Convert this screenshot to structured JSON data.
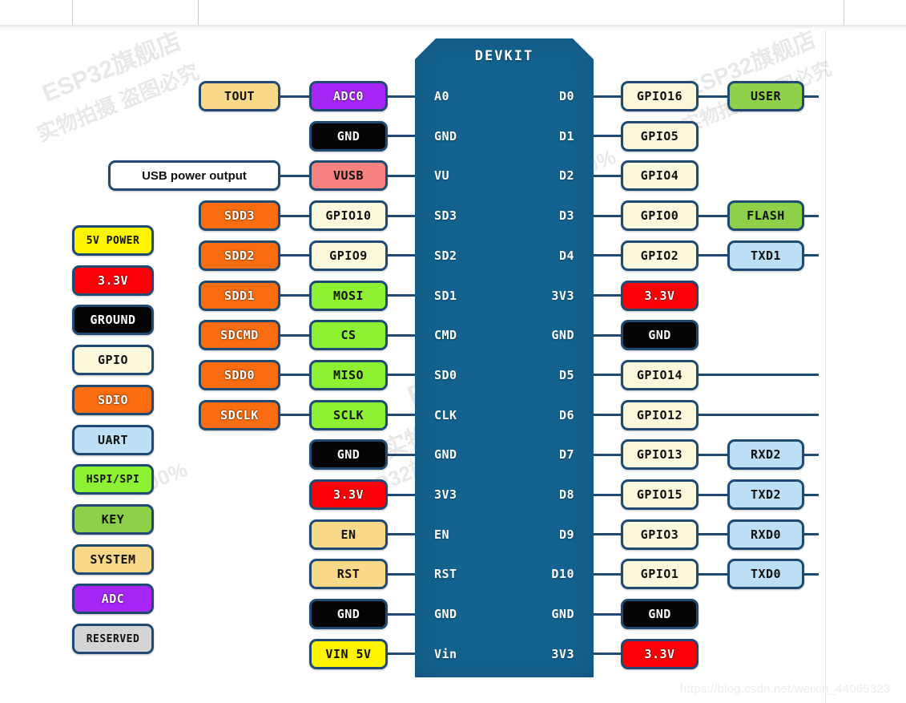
{
  "board": {
    "title": "DEVKIT",
    "left_pads": [
      "A0",
      "GND",
      "VU",
      "SD3",
      "SD2",
      "SD1",
      "CMD",
      "SD0",
      "CLK",
      "GND",
      "3V3",
      "EN",
      "RST",
      "GND",
      "Vin"
    ],
    "right_pads": [
      "D0",
      "D1",
      "D2",
      "D3",
      "D4",
      "3V3",
      "GND",
      "D5",
      "D6",
      "D7",
      "D8",
      "D9",
      "D10",
      "GND",
      "3V3"
    ]
  },
  "legend": {
    "items": [
      {
        "label": "5V POWER",
        "color": "#fdf500",
        "text": "#111111"
      },
      {
        "label": "3.3V",
        "color": "#fb0007",
        "text": "#ffffff"
      },
      {
        "label": "GROUND",
        "color": "#050505",
        "text": "#ffffff"
      },
      {
        "label": "GPIO",
        "color": "#fbf8dc",
        "text": "#111111"
      },
      {
        "label": "SDIO",
        "color": "#f96d10",
        "text": "#ffffff"
      },
      {
        "label": "UART",
        "color": "#bcdff5",
        "text": "#111111"
      },
      {
        "label": "HSPI/SPI",
        "color": "#8ef033",
        "text": "#111111"
      },
      {
        "label": "KEY",
        "color": "#8fd04a",
        "text": "#111111"
      },
      {
        "label": "SYSTEM",
        "color": "#f8d98a",
        "text": "#111111"
      },
      {
        "label": "ADC",
        "color": "#a626f5",
        "text": "#ffffff"
      },
      {
        "label": "RESERVED",
        "color": "#d4d4d4",
        "text": "#111111"
      }
    ]
  },
  "left_column": {
    "outer": [
      {
        "label": "TOUT",
        "color": "#f8d98a",
        "text": "#111111",
        "row": 0
      },
      {
        "label": "USB power output",
        "color": "#ffffff",
        "text": "#111111",
        "row": 2
      },
      {
        "label": "SDD3",
        "color": "#f96d10",
        "text": "#ffffff",
        "row": 3
      },
      {
        "label": "SDD2",
        "color": "#f96d10",
        "text": "#ffffff",
        "row": 4
      },
      {
        "label": "SDD1",
        "color": "#f96d10",
        "text": "#ffffff",
        "row": 5
      },
      {
        "label": "SDCMD",
        "color": "#f96d10",
        "text": "#ffffff",
        "row": 6
      },
      {
        "label": "SDD0",
        "color": "#f96d10",
        "text": "#ffffff",
        "row": 7
      },
      {
        "label": "SDCLK",
        "color": "#f96d10",
        "text": "#ffffff",
        "row": 8
      }
    ],
    "inner": [
      {
        "label": "ADC0",
        "color": "#a626f5",
        "text": "#ffffff",
        "row": 0
      },
      {
        "label": "GND",
        "color": "#050505",
        "text": "#ffffff",
        "row": 1
      },
      {
        "label": "VUSB",
        "color": "#f5827f",
        "text": "#111111",
        "row": 2
      },
      {
        "label": "GPIO10",
        "color": "#fbf8dc",
        "text": "#111111",
        "row": 3
      },
      {
        "label": "GPIO9",
        "color": "#fbf8dc",
        "text": "#111111",
        "row": 4
      },
      {
        "label": "MOSI",
        "color": "#8ef033",
        "text": "#111111",
        "row": 5
      },
      {
        "label": "CS",
        "color": "#8ef033",
        "text": "#111111",
        "row": 6
      },
      {
        "label": "MISO",
        "color": "#8ef033",
        "text": "#111111",
        "row": 7
      },
      {
        "label": "SCLK",
        "color": "#8ef033",
        "text": "#111111",
        "row": 8
      },
      {
        "label": "GND",
        "color": "#050505",
        "text": "#ffffff",
        "row": 9
      },
      {
        "label": "3.3V",
        "color": "#fb0007",
        "text": "#ffffff",
        "row": 10
      },
      {
        "label": "EN",
        "color": "#f8d98a",
        "text": "#111111",
        "row": 11
      },
      {
        "label": "RST",
        "color": "#f8d98a",
        "text": "#111111",
        "row": 12
      },
      {
        "label": "GND",
        "color": "#050505",
        "text": "#ffffff",
        "row": 13
      },
      {
        "label": "VIN 5V",
        "color": "#fdf500",
        "text": "#111111",
        "row": 14
      }
    ]
  },
  "right_column": {
    "inner": [
      {
        "label": "GPIO16",
        "color": "#fbf8dc",
        "text": "#111111",
        "row": 0
      },
      {
        "label": "GPIO5",
        "color": "#fbf8dc",
        "text": "#111111",
        "row": 1
      },
      {
        "label": "GPIO4",
        "color": "#fbf8dc",
        "text": "#111111",
        "row": 2
      },
      {
        "label": "GPIO0",
        "color": "#fbf8dc",
        "text": "#111111",
        "row": 3
      },
      {
        "label": "GPIO2",
        "color": "#fbf8dc",
        "text": "#111111",
        "row": 4
      },
      {
        "label": "3.3V",
        "color": "#fb0007",
        "text": "#ffffff",
        "row": 5
      },
      {
        "label": "GND",
        "color": "#050505",
        "text": "#ffffff",
        "row": 6
      },
      {
        "label": "GPIO14",
        "color": "#fbf8dc",
        "text": "#111111",
        "row": 7
      },
      {
        "label": "GPIO12",
        "color": "#fbf8dc",
        "text": "#111111",
        "row": 8
      },
      {
        "label": "GPIO13",
        "color": "#fbf8dc",
        "text": "#111111",
        "row": 9
      },
      {
        "label": "GPIO15",
        "color": "#fbf8dc",
        "text": "#111111",
        "row": 10
      },
      {
        "label": "GPIO3",
        "color": "#fbf8dc",
        "text": "#111111",
        "row": 11
      },
      {
        "label": "GPIO1",
        "color": "#fbf8dc",
        "text": "#111111",
        "row": 12
      },
      {
        "label": "GND",
        "color": "#050505",
        "text": "#ffffff",
        "row": 13
      },
      {
        "label": "3.3V",
        "color": "#fb0007",
        "text": "#ffffff",
        "row": 14
      }
    ],
    "outer": [
      {
        "label": "USER",
        "color": "#8fd04a",
        "text": "#111111",
        "row": 0
      },
      {
        "label": "FLASH",
        "color": "#8fd04a",
        "text": "#111111",
        "row": 3
      },
      {
        "label": "TXD1",
        "color": "#bcdff5",
        "text": "#111111",
        "row": 4
      },
      {
        "label": "RXD2",
        "color": "#bcdff5",
        "text": "#111111",
        "row": 9
      },
      {
        "label": "TXD2",
        "color": "#bcdff5",
        "text": "#111111",
        "row": 10
      },
      {
        "label": "RXD0",
        "color": "#bcdff5",
        "text": "#111111",
        "row": 11
      },
      {
        "label": "TXD0",
        "color": "#bcdff5",
        "text": "#111111",
        "row": 12
      }
    ]
  },
  "watermarks": {
    "csdn": "https://blog.csdn.net/weixin_44065323",
    "store": "ESP32旗舰店",
    "note": "实物拍摄 盗图必究",
    "percent": "100%"
  }
}
